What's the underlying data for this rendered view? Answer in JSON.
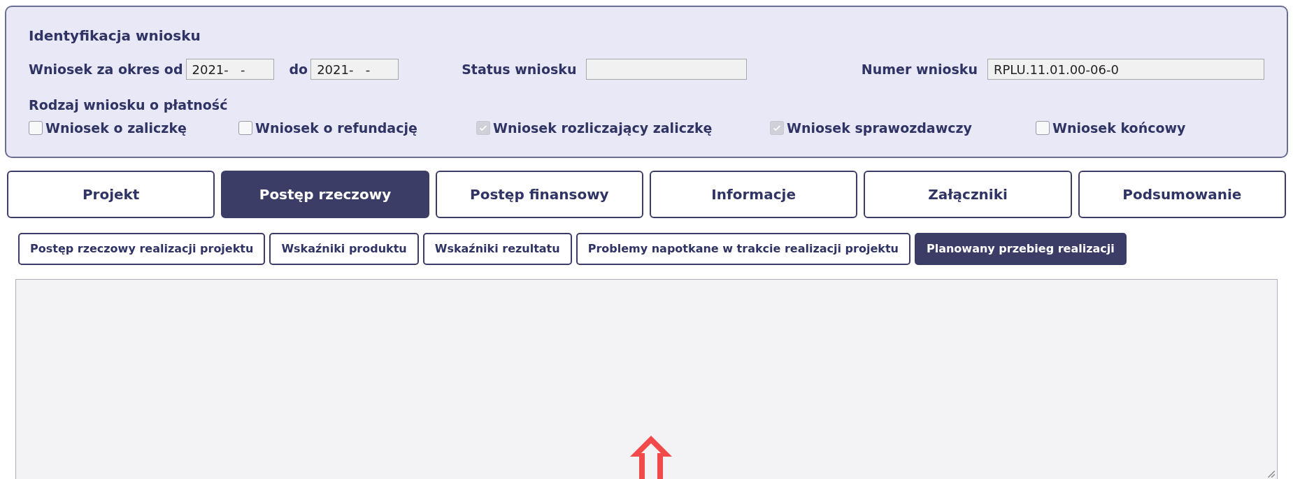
{
  "identification": {
    "title": "Identyfikacja wniosku",
    "period_from": {
      "label": "Wniosek za okres od",
      "value": "2021-   -"
    },
    "period_to": {
      "label": "do",
      "value": "2021-   -"
    },
    "status": {
      "label": "Status wniosku"
    },
    "number": {
      "label": "Numer wniosku",
      "value": "RPLU.11.01.00-06-0"
    },
    "payment_type": {
      "label": "Rodzaj wniosku o płatność",
      "options": [
        {
          "label": "Wniosek o zaliczkę",
          "checked": false,
          "disabled": false
        },
        {
          "label": "Wniosek o refundację",
          "checked": false,
          "disabled": false
        },
        {
          "label": "Wniosek rozliczający zaliczkę",
          "checked": true,
          "disabled": true
        },
        {
          "label": "Wniosek sprawozdawczy",
          "checked": true,
          "disabled": true
        },
        {
          "label": "Wniosek końcowy",
          "checked": false,
          "disabled": false
        }
      ]
    }
  },
  "tabs": [
    {
      "label": "Projekt",
      "selected": false
    },
    {
      "label": "Postęp rzeczowy",
      "selected": true
    },
    {
      "label": "Postęp finansowy",
      "selected": false
    },
    {
      "label": "Informacje",
      "selected": false
    },
    {
      "label": "Załączniki",
      "selected": false
    },
    {
      "label": "Podsumowanie",
      "selected": false
    }
  ],
  "subtabs": [
    {
      "label": "Postęp rzeczowy realizacji projektu",
      "selected": false
    },
    {
      "label": "Wskaźniki produktu",
      "selected": false
    },
    {
      "label": "Wskaźniki rezultatu",
      "selected": false
    },
    {
      "label": "Problemy napotkane w trakcie realizacji projektu",
      "selected": false
    },
    {
      "label": "Planowany przebieg realizacji",
      "selected": true
    }
  ],
  "content": {
    "kind": "text-area"
  }
}
